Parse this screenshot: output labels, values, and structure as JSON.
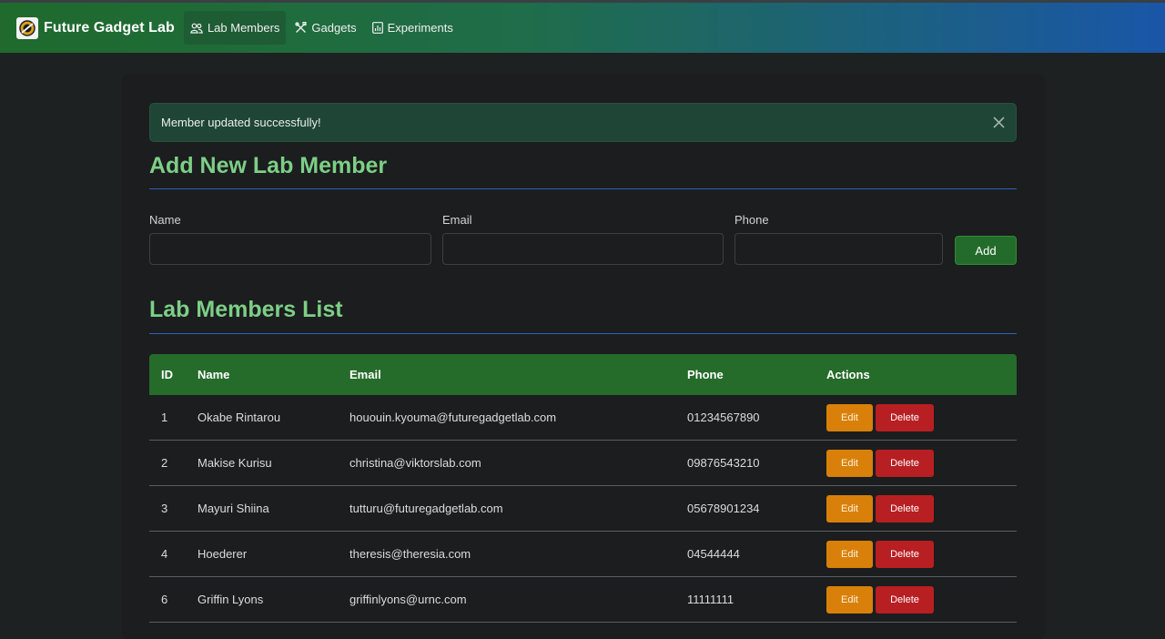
{
  "navbar": {
    "brand": "Future Gadget Lab",
    "links": [
      {
        "label": "Lab Members",
        "icon": "people-icon",
        "active": true
      },
      {
        "label": "Gadgets",
        "icon": "tools-icon",
        "active": false
      },
      {
        "label": "Experiments",
        "icon": "chart-icon",
        "active": false
      }
    ]
  },
  "alert": {
    "message": "Member updated successfully!"
  },
  "add_form": {
    "title": "Add New Lab Member",
    "name_label": "Name",
    "email_label": "Email",
    "phone_label": "Phone",
    "name_value": "",
    "email_value": "",
    "phone_value": "",
    "add_label": "Add"
  },
  "members_list": {
    "title": "Lab Members List",
    "columns": [
      "ID",
      "Name",
      "Email",
      "Phone",
      "Actions"
    ],
    "edit_label": "Edit",
    "delete_label": "Delete",
    "rows": [
      {
        "id": "1",
        "name": "Okabe Rintarou",
        "email": "hououin.kyouma@futuregadgetlab.com",
        "phone": "01234567890"
      },
      {
        "id": "2",
        "name": "Makise Kurisu",
        "email": "christina@viktorslab.com",
        "phone": "09876543210"
      },
      {
        "id": "3",
        "name": "Mayuri Shiina",
        "email": "tutturu@futuregadgetlab.com",
        "phone": "05678901234"
      },
      {
        "id": "4",
        "name": "Hoederer",
        "email": "theresis@theresia.com",
        "phone": "04544444"
      },
      {
        "id": "6",
        "name": "Griffin Lyons",
        "email": "griffinlyons@urnc.com",
        "phone": "11111111"
      }
    ]
  },
  "colors": {
    "accent_green": "#7dcf86",
    "header_green": "#256b2a",
    "edit_orange": "#d8800a",
    "delete_red": "#b81f22",
    "rule_blue": "#2d63b8"
  }
}
